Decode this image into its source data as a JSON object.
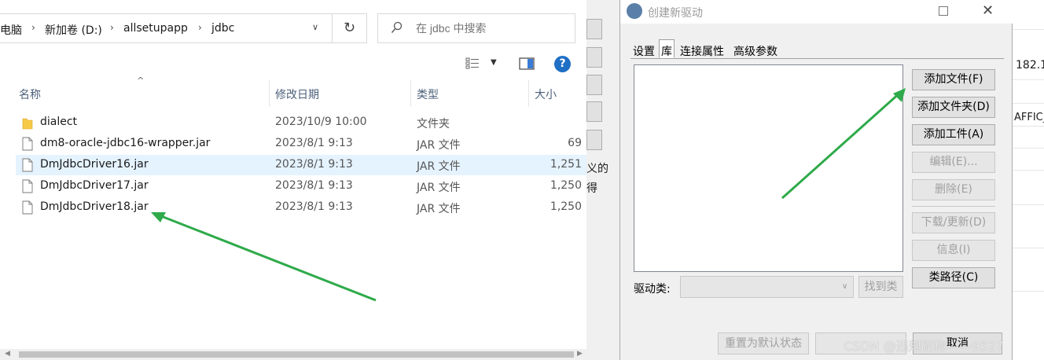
{
  "explorer": {
    "breadcrumb": [
      "电脑",
      "新加卷 (D:)",
      "allsetupapp",
      "jdbc"
    ],
    "search_placeholder": "在 jdbc 中搜索",
    "columns": {
      "name": "名称",
      "date": "修改日期",
      "type": "类型",
      "size": "大小"
    },
    "files": [
      {
        "name": "dialect",
        "date": "2023/10/9 10:00",
        "type": "文件夹",
        "size": "",
        "icon": "folder-icon"
      },
      {
        "name": "dm8-oracle-jdbc16-wrapper.jar",
        "date": "2023/8/1 9:13",
        "type": "JAR 文件",
        "size": "69",
        "icon": "file-icon"
      },
      {
        "name": "DmJdbcDriver16.jar",
        "date": "2023/8/1 9:13",
        "type": "JAR 文件",
        "size": "1,251",
        "icon": "file-icon",
        "selected": true
      },
      {
        "name": "DmJdbcDriver17.jar",
        "date": "2023/8/1 9:13",
        "type": "JAR 文件",
        "size": "1,250",
        "icon": "file-icon"
      },
      {
        "name": "DmJdbcDriver18.jar",
        "date": "2023/8/1 9:13",
        "type": "JAR 文件",
        "size": "1,250",
        "icon": "file-icon"
      }
    ]
  },
  "background": {
    "partial_texts": [
      "义的",
      "得"
    ],
    "right_texts": [
      "182.1",
      "AFFIC_I"
    ]
  },
  "dialog": {
    "title": "创建新驱动",
    "tabs": [
      "设置",
      "库",
      "连接属性",
      "高级参数"
    ],
    "active_tab": "库",
    "buttons": {
      "add_file": "添加文件(F)",
      "add_folder": "添加文件夹(D)",
      "add_artifact": "添加工件(A)",
      "edit": "编辑(E)...",
      "delete": "删除(E)",
      "download_update": "下载/更新(D)",
      "info": "信息(I)",
      "classpath": "类路径(C)"
    },
    "driver_class_label": "驱动类:",
    "find_class": "找到类",
    "reset_default": "重置为默认状态",
    "cancel": "取消"
  },
  "watermark": "CSDN @违规昵称——9527",
  "colors": {
    "annotation_arrow": "#2eaa4a",
    "selection": "#e5f3ff",
    "help_icon": "#1f6fc5"
  }
}
